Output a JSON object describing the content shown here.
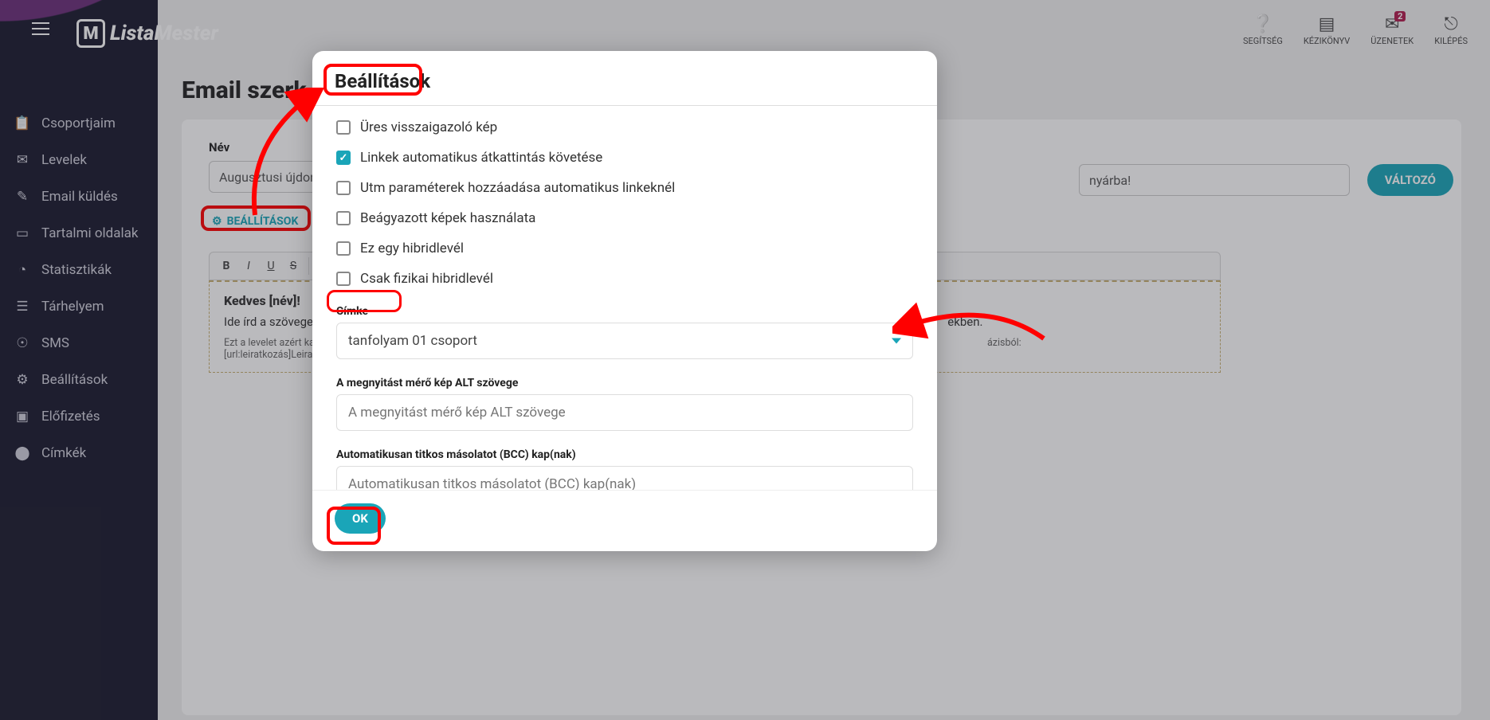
{
  "logo_text": "ListaMester",
  "sidebar": {
    "items": [
      {
        "label": "Csoportjaim",
        "icon": "clipboard-icon"
      },
      {
        "label": "Levelek",
        "icon": "envelope-icon"
      },
      {
        "label": "Email küldés",
        "icon": "pencil-icon"
      },
      {
        "label": "Tartalmi oldalak",
        "icon": "book-icon"
      },
      {
        "label": "Statisztikák",
        "icon": "chart-icon"
      },
      {
        "label": "Tárhelyem",
        "icon": "archive-icon"
      },
      {
        "label": "SMS",
        "icon": "sms-icon"
      },
      {
        "label": "Beállítások",
        "icon": "gear-icon"
      },
      {
        "label": "Előfizetés",
        "icon": "card-icon"
      },
      {
        "label": "Címkék",
        "icon": "tag-icon"
      }
    ]
  },
  "top_right": {
    "help": {
      "label": "SEGÍTSÉG"
    },
    "manual": {
      "label": "KÉZIKÖNYV"
    },
    "messages": {
      "label": "ÜZENETEK",
      "badge": "2"
    },
    "logout": {
      "label": "KILÉPÉS"
    }
  },
  "page": {
    "title": "Email szerk",
    "name_label": "Név",
    "name_value": "Augusztusi újdons",
    "subject_value": "nyárba!",
    "valtozo_label": "VÁLTOZÓ",
    "settings_button": "BEÁLLÍTÁSOK",
    "editor": {
      "greeting": "Kedves [név]!",
      "hint_prefix": "Ide írd a szöveget.",
      "hint_suffix": "ekben.",
      "footer_prefix": "Ezt a levelet azért kapta",
      "footer_suffix": "ázisból: [url:leiratkozás]Leiratkozás[/url:leiratkozás]"
    }
  },
  "modal": {
    "title": "Beállítások",
    "checks": [
      {
        "label": "Üres visszaigazoló kép",
        "checked": false
      },
      {
        "label": "Linkek automatikus átkattintás követése",
        "checked": true
      },
      {
        "label": "Utm paraméterek hozzáadása automatikus linkeknél",
        "checked": false
      },
      {
        "label": "Beágyazott képek használata",
        "checked": false
      },
      {
        "label": "Ez egy hibridlevél",
        "checked": false
      },
      {
        "label": "Csak fizikai hibridlevél",
        "checked": false
      }
    ],
    "cimke_label": "Címke",
    "cimke_value": "tanfolyam 01 csoport",
    "alt_label": "A megnyitást mérő kép ALT szövege",
    "alt_placeholder": "A megnyitást mérő kép ALT szövege",
    "bcc_label": "Automatikusan titkos másolatot (BCC) kap(nak)",
    "bcc_placeholder": "Automatikusan titkos másolatot (BCC) kap(nak)",
    "ok_label": "OK"
  },
  "colors": {
    "accent": "#1aa5b8",
    "annotation": "#ff0000",
    "sidebar_bg": "#1a1a2e",
    "brand_purple": "#6b2e7a"
  }
}
